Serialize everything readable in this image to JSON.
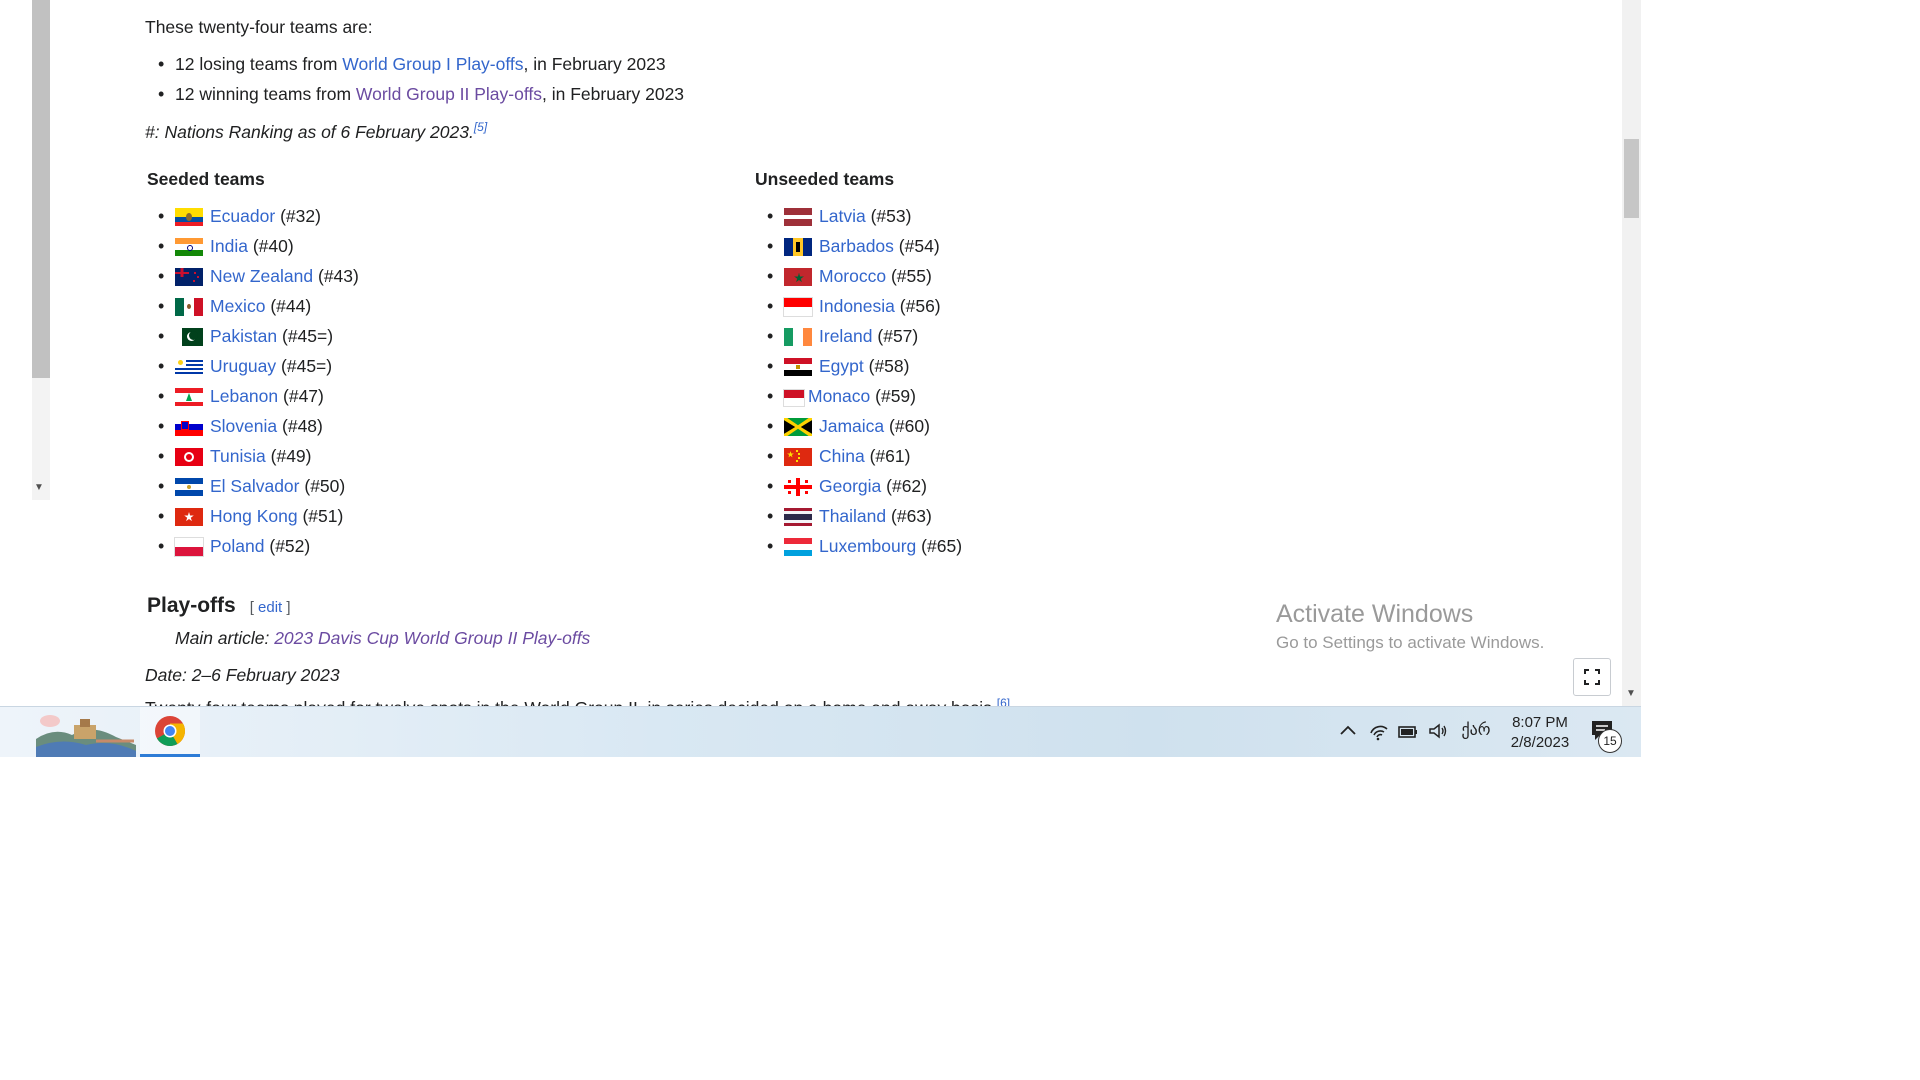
{
  "intro": {
    "teams_intro": "These twenty-four teams are:",
    "items": [
      {
        "prefix": "12 losing teams from ",
        "link": "World Group I Play-offs",
        "suffix": ", in February 2023"
      },
      {
        "prefix": "12 winning teams from ",
        "link": "World Group II Play-offs",
        "suffix": ", in February 2023"
      }
    ],
    "note": "#: Nations Ranking as of 6 February 2023.",
    "note_ref": "[5]"
  },
  "seeded": {
    "heading": "Seeded teams",
    "teams": [
      {
        "name": "Ecuador",
        "rank": "(#32)",
        "flag": "ecuador-flag-icon"
      },
      {
        "name": "India",
        "rank": "(#40)",
        "flag": "india-flag-icon"
      },
      {
        "name": "New Zealand",
        "rank": "(#43)",
        "flag": "new-zealand-flag-icon"
      },
      {
        "name": "Mexico",
        "rank": "(#44)",
        "flag": "mexico-flag-icon"
      },
      {
        "name": "Pakistan",
        "rank": "(#45=)",
        "flag": "pakistan-flag-icon"
      },
      {
        "name": "Uruguay",
        "rank": "(#45=)",
        "flag": "uruguay-flag-icon"
      },
      {
        "name": "Lebanon",
        "rank": "(#47)",
        "flag": "lebanon-flag-icon"
      },
      {
        "name": "Slovenia",
        "rank": "(#48)",
        "flag": "slovenia-flag-icon"
      },
      {
        "name": "Tunisia",
        "rank": "(#49)",
        "flag": "tunisia-flag-icon"
      },
      {
        "name": "El Salvador",
        "rank": "(#50)",
        "flag": "el-salvador-flag-icon"
      },
      {
        "name": "Hong Kong",
        "rank": "(#51)",
        "flag": "hong-kong-flag-icon"
      },
      {
        "name": "Poland",
        "rank": "(#52)",
        "flag": "poland-flag-icon"
      }
    ]
  },
  "unseeded": {
    "heading": "Unseeded teams",
    "teams": [
      {
        "name": "Latvia",
        "rank": "(#53)",
        "flag": "latvia-flag-icon"
      },
      {
        "name": "Barbados",
        "rank": "(#54)",
        "flag": "barbados-flag-icon"
      },
      {
        "name": "Morocco",
        "rank": "(#55)",
        "flag": "morocco-flag-icon"
      },
      {
        "name": "Indonesia",
        "rank": "(#56)",
        "flag": "indonesia-flag-icon"
      },
      {
        "name": "Ireland",
        "rank": "(#57)",
        "flag": "ireland-flag-icon"
      },
      {
        "name": "Egypt",
        "rank": "(#58)",
        "flag": "egypt-flag-icon"
      },
      {
        "name": "Monaco",
        "rank": "(#59)",
        "flag": "monaco-flag-icon"
      },
      {
        "name": "Jamaica",
        "rank": "(#60)",
        "flag": "jamaica-flag-icon"
      },
      {
        "name": "China",
        "rank": "(#61)",
        "flag": "china-flag-icon"
      },
      {
        "name": "Georgia",
        "rank": "(#62)",
        "flag": "georgia-flag-icon"
      },
      {
        "name": "Thailand",
        "rank": "(#63)",
        "flag": "thailand-flag-icon"
      },
      {
        "name": "Luxembourg",
        "rank": "(#65)",
        "flag": "luxembourg-flag-icon"
      }
    ]
  },
  "playoffs": {
    "heading": "Play-offs",
    "edit_open": "[ ",
    "edit_label": "edit",
    "edit_close": " ]",
    "main_article_prefix": "Main article: ",
    "main_article_link": "2023 Davis Cup World Group II Play-offs",
    "date": "Date: 2–6 February 2023",
    "partial_text": "Twenty-four teams played for twelve spots in the World Group II, in series decided on a home and away basis.",
    "partial_ref": "[6]"
  },
  "watermark": {
    "title": "Activate Windows",
    "subtitle": "Go to Settings to activate Windows."
  },
  "taskbar": {
    "language": "ქარ",
    "time": "8:07 PM",
    "date": "2/8/2023",
    "notifications": "15"
  },
  "colors": {
    "link": "#3366cc",
    "visited_link": "#6b4ba1",
    "taskbar_accent": "#2d7cd6"
  }
}
